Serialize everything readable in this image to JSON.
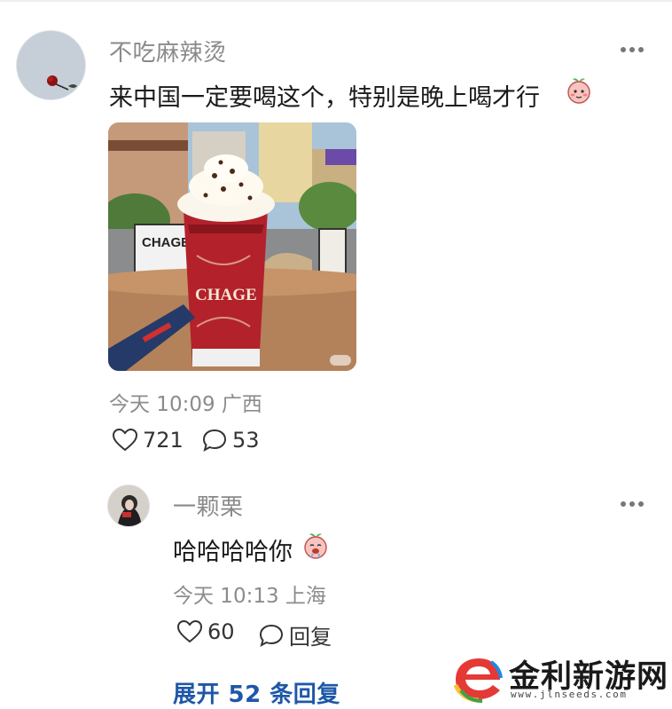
{
  "post": {
    "username": "不吃麻辣烫",
    "text": "来中国一定要喝这个，特别是晚上喝才行",
    "emoji": "peach-face-emoji",
    "photo_brand": "CHAGE",
    "time": "今天 10:09",
    "location": "广西",
    "likes": "721",
    "comments": "53"
  },
  "reply": {
    "username": "一颗栗",
    "text": "哈哈哈哈你",
    "emoji": "peach-face-emoji",
    "time": "今天 10:13",
    "location": "上海",
    "likes": "60",
    "reply_label": "回复"
  },
  "expand_label": "展开 52 条回复",
  "watermark": {
    "title": "金利新游网",
    "url": "www.jlnseeds.com"
  },
  "colors": {
    "link": "#1e57a8",
    "meta": "#8c8c8c",
    "cup_red": "#b3212b"
  }
}
